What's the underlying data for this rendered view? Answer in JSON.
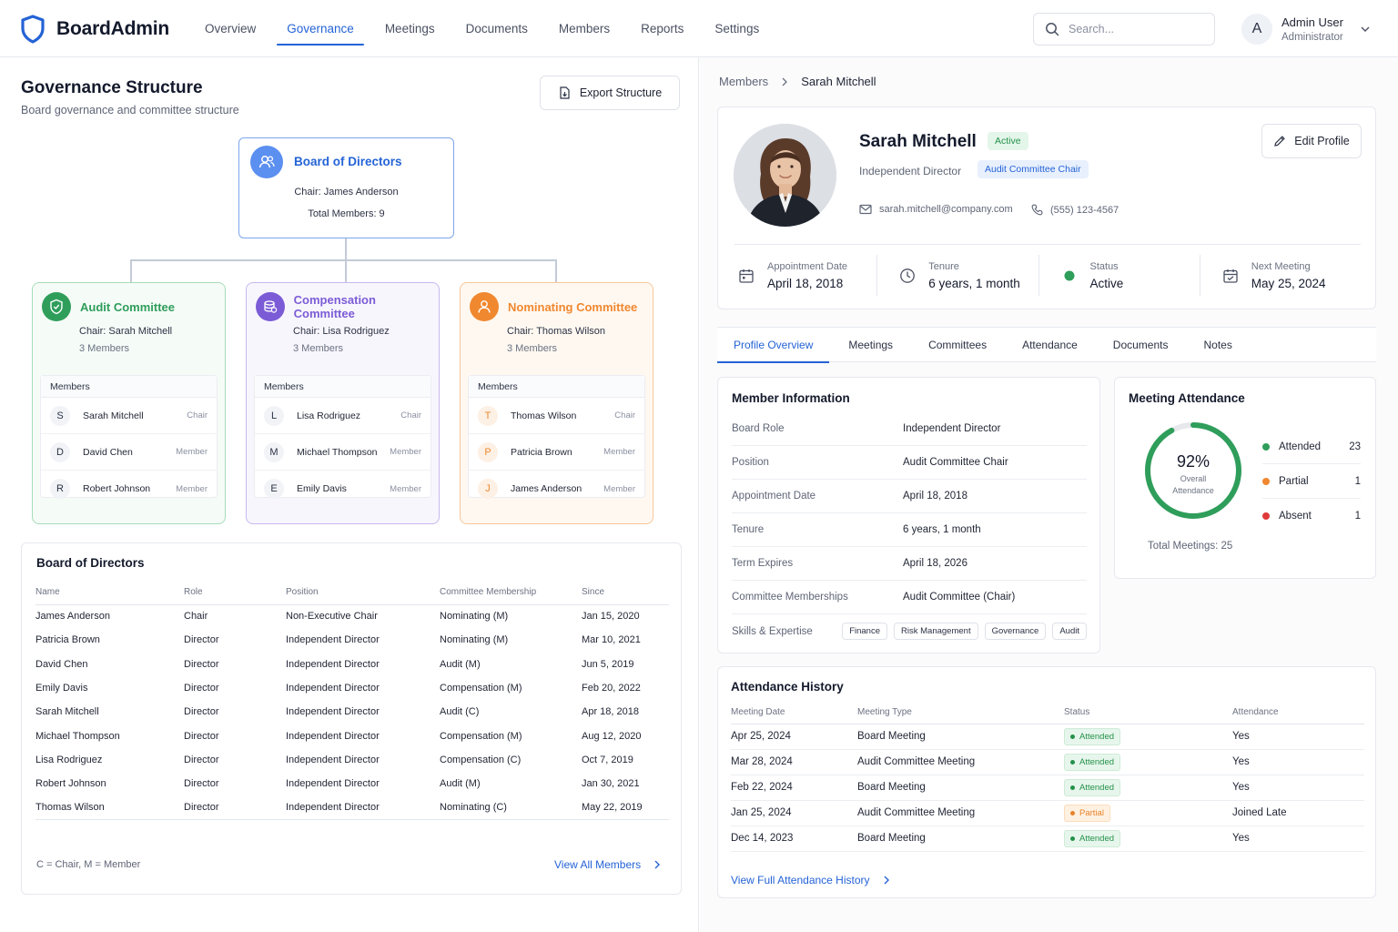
{
  "app": {
    "name": "BoardAdmin"
  },
  "nav": [
    {
      "label": "Overview",
      "active": false
    },
    {
      "label": "Governance",
      "active": true
    },
    {
      "label": "Meetings",
      "active": false
    },
    {
      "label": "Documents",
      "active": false
    },
    {
      "label": "Members",
      "active": false
    },
    {
      "label": "Reports",
      "active": false
    },
    {
      "label": "Settings",
      "active": false
    }
  ],
  "search": {
    "placeholder": "Search...",
    "value": ""
  },
  "user": {
    "initial": "A",
    "name": "Admin User",
    "role": "Administrator"
  },
  "governance": {
    "title": "Governance Structure",
    "subtitle": "Board governance and committee structure",
    "export_label": "Export Structure",
    "board": {
      "title": "Board of Directors",
      "chair": "Chair: James Anderson",
      "total": "Total Members: 9"
    },
    "committees": [
      {
        "title": "Audit Committee",
        "chair": "Chair: Sarah Mitchell",
        "count": "3 Members",
        "members_label": "Members",
        "members": [
          {
            "initial": "S",
            "name": "Sarah Mitchell",
            "role": "Chair"
          },
          {
            "initial": "D",
            "name": "David Chen",
            "role": "Member"
          },
          {
            "initial": "R",
            "name": "Robert Johnson",
            "role": "Member"
          }
        ]
      },
      {
        "title": "Compensation Committee",
        "chair": "Chair: Lisa Rodriguez",
        "count": "3 Members",
        "members_label": "Members",
        "members": [
          {
            "initial": "L",
            "name": "Lisa Rodriguez",
            "role": "Chair"
          },
          {
            "initial": "M",
            "name": "Michael Thompson",
            "role": "Member"
          },
          {
            "initial": "E",
            "name": "Emily Davis",
            "role": "Member"
          }
        ]
      },
      {
        "title": "Nominating Committee",
        "chair": "Chair: Thomas Wilson",
        "count": "3 Members",
        "members_label": "Members",
        "members": [
          {
            "initial": "T",
            "name": "Thomas Wilson",
            "role": "Chair"
          },
          {
            "initial": "P",
            "name": "Patricia Brown",
            "role": "Member"
          },
          {
            "initial": "J",
            "name": "James Anderson",
            "role": "Member"
          }
        ]
      }
    ]
  },
  "directors": {
    "title": "Board of Directors",
    "columns": [
      "Name",
      "Role",
      "Position",
      "Committee Membership",
      "Since"
    ],
    "rows": [
      [
        "James Anderson",
        "Chair",
        "Non-Executive Chair",
        "Nominating (M)",
        "Jan 15, 2020"
      ],
      [
        "Patricia Brown",
        "Director",
        "Independent Director",
        "Nominating (M)",
        "Mar 10, 2021"
      ],
      [
        "David Chen",
        "Director",
        "Independent Director",
        "Audit (M)",
        "Jun 5, 2019"
      ],
      [
        "Emily Davis",
        "Director",
        "Independent Director",
        "Compensation (M)",
        "Feb 20, 2022"
      ],
      [
        "Sarah Mitchell",
        "Director",
        "Independent Director",
        "Audit (C)",
        "Apr 18, 2018"
      ],
      [
        "Michael Thompson",
        "Director",
        "Independent Director",
        "Compensation (M)",
        "Aug 12, 2020"
      ],
      [
        "Lisa Rodriguez",
        "Director",
        "Independent Director",
        "Compensation (C)",
        "Oct 7, 2019"
      ],
      [
        "Robert Johnson",
        "Director",
        "Independent Director",
        "Audit (M)",
        "Jan 30, 2021"
      ],
      [
        "Thomas Wilson",
        "Director",
        "Independent Director",
        "Nominating (C)",
        "May 22, 2019"
      ]
    ],
    "legend": "C = Chair, M = Member",
    "view_all": "View All Members"
  },
  "breadcrumb": [
    "Members",
    "Sarah Mitchell"
  ],
  "profile": {
    "name": "Sarah Mitchell",
    "status_badge": "Active",
    "type": "Independent Director",
    "role_badge": "Audit Committee Chair",
    "email": "sarah.mitchell@company.com",
    "phone": "(555) 123-4567",
    "edit_label": "Edit Profile",
    "stats": [
      {
        "label": "Appointment Date",
        "value": "April 18, 2018",
        "icon": "calendar-icon"
      },
      {
        "label": "Tenure",
        "value": "6 years, 1 month",
        "icon": "clock-icon"
      },
      {
        "label": "Status",
        "value": "Active",
        "icon": "status-dot-icon"
      },
      {
        "label": "Next Meeting",
        "value": "May 25, 2024",
        "icon": "calendar-check-icon"
      }
    ]
  },
  "tabs": [
    {
      "label": "Profile Overview",
      "active": true
    },
    {
      "label": "Meetings",
      "active": false
    },
    {
      "label": "Committees",
      "active": false
    },
    {
      "label": "Attendance",
      "active": false
    },
    {
      "label": "Documents",
      "active": false
    },
    {
      "label": "Notes",
      "active": false
    }
  ],
  "member_info": {
    "title": "Member Information",
    "rows": [
      {
        "key": "Board Role",
        "value": "Independent Director"
      },
      {
        "key": "Position",
        "value": "Audit Committee Chair"
      },
      {
        "key": "Appointment Date",
        "value": "April 18, 2018"
      },
      {
        "key": "Tenure",
        "value": "6 years, 1 month"
      },
      {
        "key": "Term Expires",
        "value": "April 18, 2026"
      },
      {
        "key": "Committee Memberships",
        "value": "Audit Committee (Chair)"
      }
    ],
    "skills_label": "Skills & Expertise",
    "skills": [
      "Finance",
      "Risk Management",
      "Governance",
      "Audit"
    ]
  },
  "attendance": {
    "title": "Meeting Attendance",
    "percent_label": "92%",
    "percent": 92,
    "caption_1": "Overall",
    "caption_2": "Attendance",
    "legend": [
      {
        "name": "Attended",
        "count": "23",
        "color": "#2f9e5b"
      },
      {
        "name": "Partial",
        "count": "1",
        "color": "#f0882f"
      },
      {
        "name": "Absent",
        "count": "1",
        "color": "#e03a3a"
      }
    ],
    "total": "Total Meetings: 25"
  },
  "history": {
    "title": "Attendance History",
    "columns": [
      "Meeting Date",
      "Meeting Type",
      "Status",
      "Attendance"
    ],
    "rows": [
      {
        "date": "Apr 25, 2024",
        "type": "Board Meeting",
        "status": "Attended",
        "kind": "ok",
        "attendance": "Yes"
      },
      {
        "date": "Mar 28, 2024",
        "type": "Audit Committee Meeting",
        "status": "Attended",
        "kind": "ok",
        "attendance": "Yes"
      },
      {
        "date": "Feb 22, 2024",
        "type": "Board Meeting",
        "status": "Attended",
        "kind": "ok",
        "attendance": "Yes"
      },
      {
        "date": "Jan 25, 2024",
        "type": "Audit Committee Meeting",
        "status": "Partial",
        "kind": "part",
        "attendance": "Joined Late"
      },
      {
        "date": "Dec 14, 2023",
        "type": "Board Meeting",
        "status": "Attended",
        "kind": "ok",
        "attendance": "Yes"
      }
    ],
    "view_full": "View Full Attendance History"
  },
  "colors": {
    "accent": "#2463d6",
    "audit": "#2f9e5b",
    "compensation": "#7b5cd6",
    "nominating": "#f0882f"
  }
}
